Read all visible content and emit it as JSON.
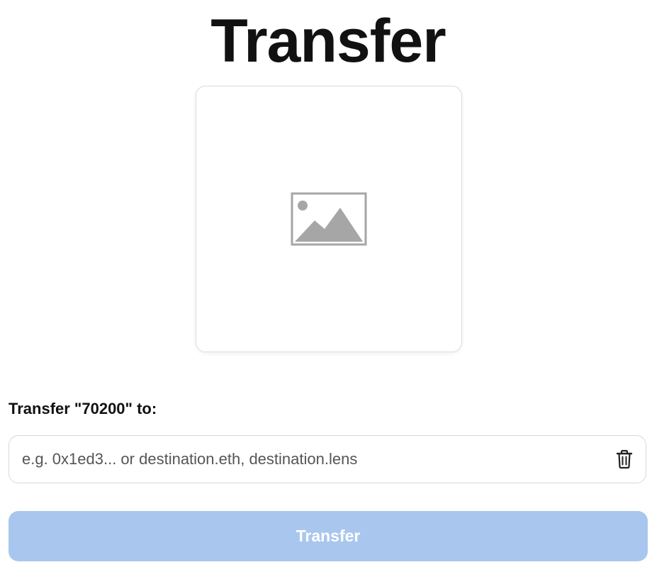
{
  "header": {
    "title": "Transfer"
  },
  "preview": {
    "icon": "image-placeholder-icon",
    "icon_color": "#a6a6a6"
  },
  "form": {
    "label": "Transfer \"70200\" to:",
    "recipient_value": "",
    "recipient_placeholder": "e.g. 0x1ed3... or destination.eth, destination.lens",
    "clear_icon": "trash-icon",
    "submit_label": "Transfer",
    "submit_state": "disabled",
    "submit_color": "#a9c6ee"
  }
}
